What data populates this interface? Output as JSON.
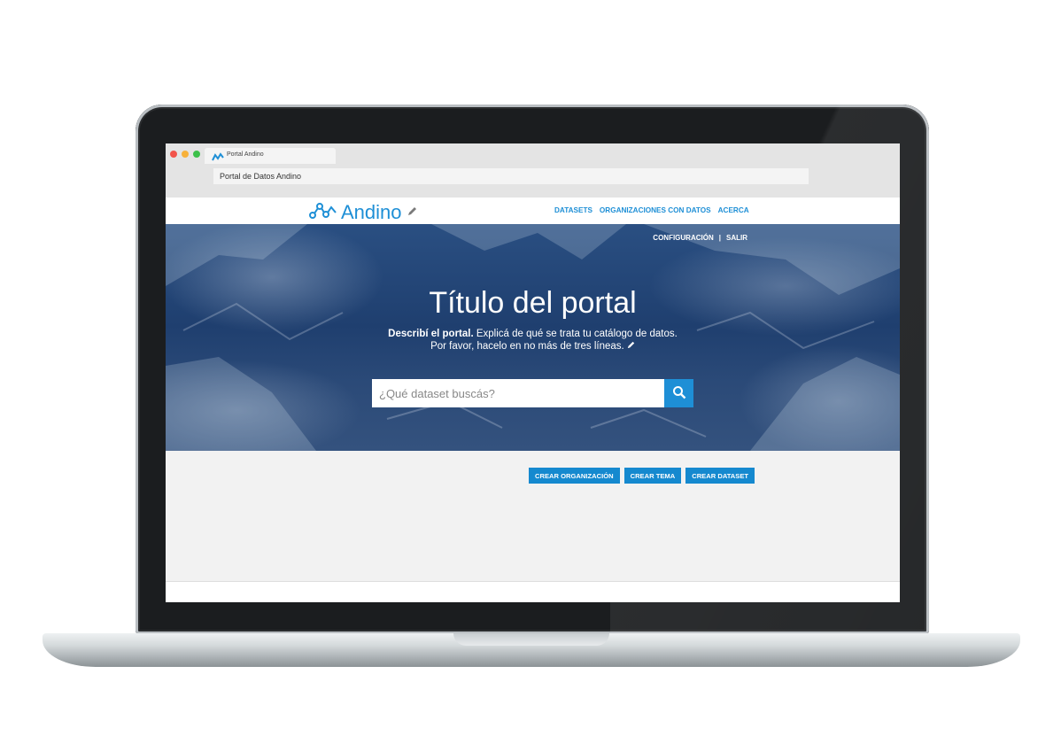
{
  "browser": {
    "tab_title": "Portal Andino",
    "address": "Portal de Datos Andino"
  },
  "site": {
    "logo_text": "Andino",
    "nav": [
      "DATASETS",
      "ORGANIZACIONES CON DATOS",
      "ACERCA"
    ],
    "admin": {
      "config": "CONFIGURACIÓN",
      "separator": "|",
      "logout": "SALIR"
    },
    "hero": {
      "title": "Título del portal",
      "desc_bold": "Describí el portal.",
      "desc_rest": " Explicá de qué se trata tu catálogo de datos.",
      "desc_line2": "Por favor, hacelo en no más de tres líneas."
    },
    "search": {
      "placeholder": "¿Qué dataset buscás?"
    },
    "actions": [
      "CREAR ORGANIZACIÓN",
      "CREAR TEMA",
      "CREAR DATASET"
    ]
  },
  "colors": {
    "accent": "#1e8fd6",
    "hero": "#1f3f6f",
    "page_bg": "#f2f2f2"
  },
  "icons": [
    "andino-logo-icon",
    "pencil-icon",
    "search-icon"
  ]
}
